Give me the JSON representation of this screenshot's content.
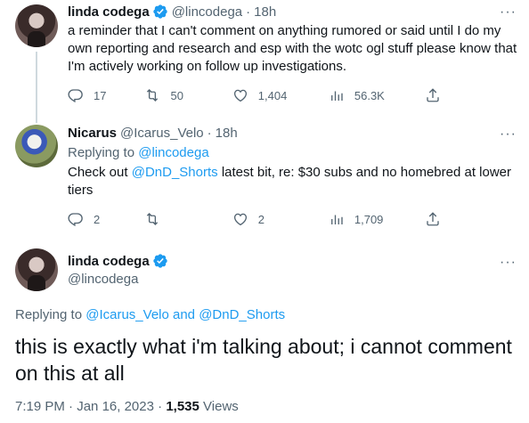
{
  "tweet1": {
    "name": "linda codega",
    "handle": "@lincodega",
    "separator": "·",
    "time": "18h",
    "text": "a reminder that I can't comment on anything rumored or said until I do my own reporting and research and esp with the wotc ogl stuff please know that I'm actively working on follow up investigations.",
    "replies": "17",
    "retweets": "50",
    "likes": "1,404",
    "views": "56.3K"
  },
  "tweet2": {
    "name": "Nicarus",
    "handle": "@Icarus_Velo",
    "separator": "·",
    "time": "18h",
    "replying_prefix": "Replying to",
    "replying_user": "@lincodega",
    "text_before": "Check out",
    "mention": "@DnD_Shorts",
    "text_after": "latest bit, re: $30 subs and no homebred at lower tiers",
    "replies": "2",
    "likes": "2",
    "views": "1,709"
  },
  "main": {
    "name": "linda codega",
    "handle": "@lincodega",
    "replying_prefix": "Replying to",
    "replying_users": "@Icarus_Velo and @DnD_Shorts",
    "text": "this is exactly what i'm talking about; i cannot comment on this at all",
    "time": "7:19 PM",
    "separator": "·",
    "date": "Jan 16, 2023",
    "views_count": "1,535",
    "views_label": "Views"
  },
  "more_icon": "···",
  "colors": {
    "link": "#1d9bf0",
    "secondary": "#536471",
    "verified": "#1d9bf0",
    "line": "#cfd9de"
  }
}
